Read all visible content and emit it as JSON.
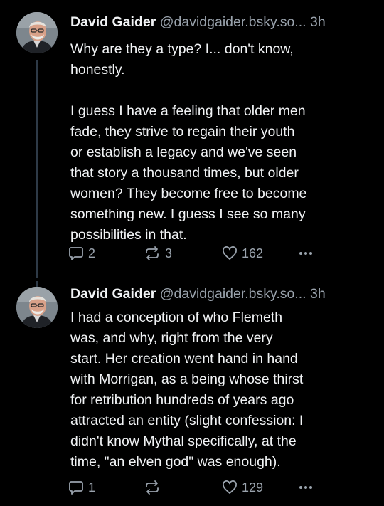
{
  "posts": [
    {
      "author": {
        "name": "David Gaider",
        "handle": "@davidgaider.bsky.so...",
        "avatar_icon": "avatar-portrait-icon"
      },
      "time": "3h",
      "lines_paragraph_1": [
        "Why are they a type? I... don't know,",
        "honestly."
      ],
      "lines_paragraph_2": [
        "I guess I have a feeling that older men",
        "fade, they strive to regain their youth",
        "or establish a legacy and we've seen",
        "that story a thousand times, but older",
        "women? They become free to become",
        "something new. I guess I see so many",
        "possibilities in that."
      ],
      "actions": {
        "replies": "2",
        "reposts": "3",
        "likes": "162"
      }
    },
    {
      "author": {
        "name": "David Gaider",
        "handle": "@davidgaider.bsky.so...",
        "avatar_icon": "avatar-portrait-icon"
      },
      "time": "3h",
      "lines": [
        "I had a conception of who Flemeth",
        "was, and why, right from the very",
        "start. Her creation went hand in hand",
        "with Morrigan, as a being whose thirst",
        "for retribution hundreds of years ago",
        "attracted an entity (slight confession: I",
        "didn't know Mythal specifically, at the",
        "time, \"an elven god\" was enough)."
      ],
      "actions": {
        "replies": "1",
        "reposts": "",
        "likes": "129"
      }
    }
  ],
  "colors": {
    "background": "#000000",
    "text": "#f1f3f5",
    "muted": "#9aa3ad",
    "thread_line": "#2e3a47"
  },
  "icons": {
    "reply": "reply-icon",
    "repost": "repost-icon",
    "like": "heart-icon",
    "more": "more-options-icon"
  }
}
